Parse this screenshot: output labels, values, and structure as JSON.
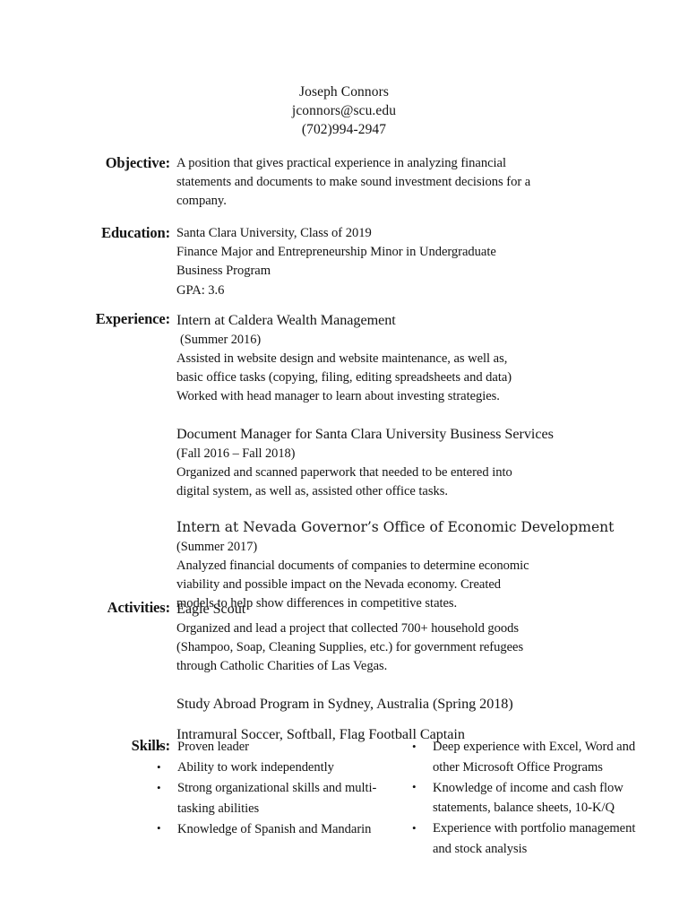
{
  "document": {
    "type": "resume",
    "background_color": "#ffffff",
    "text_color": "#141414"
  },
  "header": {
    "name": "Joseph Connors",
    "email": "jconnors@scu.edu",
    "phone": "(702)994-2947"
  },
  "sections": {
    "objective": {
      "label": "Objective:",
      "lines": [
        "A position that gives practical experience in analyzing financial",
        "statements and documents to make sound investment decisions for a",
        "company."
      ]
    },
    "education": {
      "label": "Education:",
      "lines": [
        "Santa Clara University, Class of 2019",
        "Finance Major and Entrepreneurship Minor in Undergraduate",
        "Business Program",
        "GPA: 3.6"
      ]
    },
    "experience": {
      "label": "Experience:",
      "entries": [
        {
          "title": "Intern at Caldera Wealth Management",
          "dates": "(Summer 2016)",
          "lines": [
            "Assisted in website design and website maintenance, as well as,",
            "basic office tasks (copying, filing, editing spreadsheets and data)",
            "Worked with head manager to learn about investing strategies."
          ]
        },
        {
          "title": "Document Manager for Santa Clara University Business Services",
          "dates": "(Fall 2016 – Fall 2018)",
          "lines": [
            "Organized and scanned paperwork that needed to be entered into",
            "digital system, as well as, assisted other office tasks."
          ]
        },
        {
          "title": "Intern at Nevada Governor’s Office of Economic Development",
          "dates": "(Summer 2017)",
          "lines": [
            "Analyzed financial documents of companies to determine economic",
            "viability and possible impact on the Nevada economy. Created",
            "models to help show differences in competitive states."
          ]
        }
      ]
    },
    "activities": {
      "label": "Activities:",
      "entries": [
        {
          "title": "Eagle Scout",
          "lines": [
            "Organized and lead a project that collected 700+ household goods",
            "(Shampoo, Soap, Cleaning Supplies, etc.) for government refugees",
            " through Catholic Charities of Las Vegas."
          ]
        },
        {
          "title": "Study Abroad Program in Sydney, Australia (Spring 2018)",
          "lines": []
        },
        {
          "title": "Intramural Soccer, Softball, Flag Football Captain",
          "lines": []
        }
      ]
    },
    "skills": {
      "label": "Skills:",
      "left_column": [
        "Proven leader",
        "Ability to work independently",
        "Strong organizational skills and multi-tasking abilities",
        "Knowledge of Spanish and Mandarin"
      ],
      "right_column": [
        "Deep experience with Excel, Word and other Microsoft Office Programs",
        "Knowledge of income and cash flow statements, balance sheets, 10-K/Q",
        "Experience with portfolio management and stock analysis"
      ]
    }
  }
}
